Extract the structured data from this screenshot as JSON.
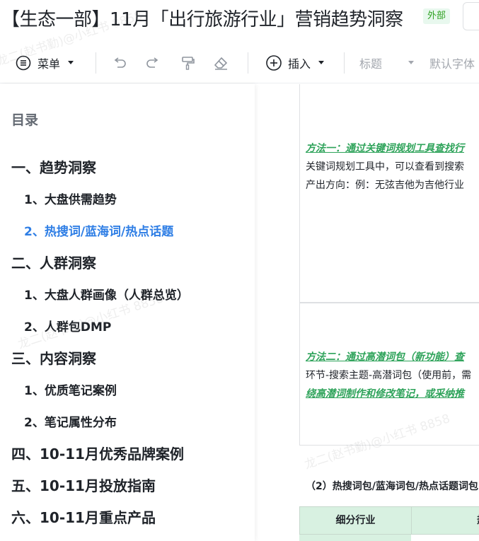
{
  "doc": {
    "title": "【生态一部】11月「出行旅游行业」营销趋势洞察",
    "badge": "外部"
  },
  "toolbar": {
    "menu_label": "菜单",
    "insert_label": "插入",
    "heading_label": "标题",
    "font_label": "默认字体"
  },
  "toc": {
    "heading": "目录",
    "items": [
      {
        "label": "一、趋势洞察"
      },
      {
        "label": "1、大盘供需趋势"
      },
      {
        "label": "2、热搜词/蓝海词/热点话题"
      },
      {
        "label": "二、人群洞察"
      },
      {
        "label": "1、大盘人群画像（人群总览）"
      },
      {
        "label": "2、人群包DMP"
      },
      {
        "label": "三、内容洞察"
      },
      {
        "label": "1、优质笔记案例"
      },
      {
        "label": "2、笔记属性分布"
      },
      {
        "label": "四、10-11月优秀品牌案例"
      },
      {
        "label": "五、10-11月投放指南"
      },
      {
        "label": "六、10-11月重点产品"
      }
    ]
  },
  "content": {
    "method1_title": "方法一：通过关键词规划工具查找行",
    "method1_line1": "关键词规划工具中，可以查看到搜索",
    "method1_line2": "产出方向：例：无弦吉他为吉他行业",
    "method2_title": "方法二：通过高潜词包（新功能）查",
    "method2_line1": "环节-搜索主题-高潜词包（使用前，需",
    "method2_line2": "绕高潜词制作和修改笔记，或采纳推",
    "section2_label": "（2）热搜词包/蓝海词包/热点话题词包",
    "table": {
      "col1": "细分行业",
      "col2": "热"
    }
  },
  "watermark": "龙二(赵书勤)@小红书 8858"
}
